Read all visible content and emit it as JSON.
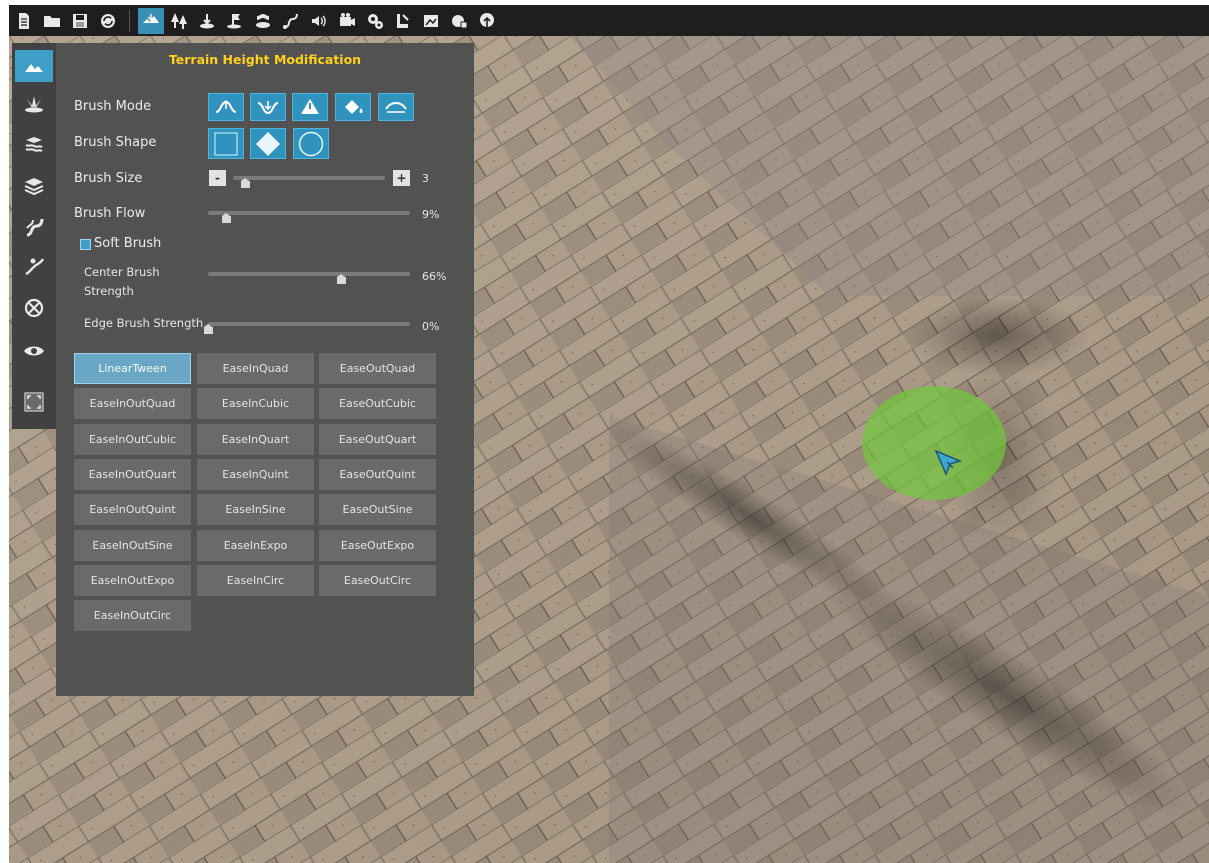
{
  "toolbar": {
    "file_icons": [
      "new-file-icon",
      "open-folder-icon",
      "save-icon",
      "refresh-icon"
    ],
    "tool_icons": [
      "terrain-height-icon",
      "trees-icon",
      "place-object-icon",
      "flag-icon",
      "water-icon",
      "path-icon",
      "sound-icon",
      "camera-icon",
      "gears-icon",
      "lighting-icon",
      "paint-icon",
      "plugin-icon",
      "nature-icon"
    ],
    "active_tool": "terrain-height-icon"
  },
  "rail": {
    "items": [
      "terrain-raise-icon",
      "grass-icon",
      "layers-texture-icon",
      "stack-icon",
      "road-icon",
      "path-tool-icon",
      "no-entry-icon",
      "eye-icon",
      "fullscreen-icon"
    ],
    "active": "terrain-raise-icon"
  },
  "panel": {
    "title": "Terrain Height Modification",
    "brush_mode_label": "Brush Mode",
    "brush_mode_icons": [
      "raise-icon",
      "lower-icon",
      "flatten-icon",
      "fill-icon",
      "smooth-icon"
    ],
    "brush_shape_label": "Brush Shape",
    "brush_shapes": [
      "square-shape-icon",
      "diamond-shape-icon",
      "circle-shape-icon"
    ],
    "brush_size_label": "Brush Size",
    "brush_size_minus": "-",
    "brush_size_plus": "+",
    "brush_size_value": "3",
    "brush_size_level": 0.08,
    "brush_flow_label": "Brush Flow",
    "brush_flow_value": "9%",
    "brush_flow_level": 0.09,
    "soft_brush_label": "Soft Brush",
    "soft_brush_checked": true,
    "center_strength_label_line1": "Center Brush",
    "center_strength_label_line2": "Strength",
    "center_strength_value": "66%",
    "center_strength_level": 0.66,
    "edge_strength_label": "Edge Brush Strength",
    "edge_strength_value": "0%",
    "edge_strength_level": 0.0,
    "easing": [
      [
        "LinearTween",
        "EaseInQuad",
        "EaseOutQuad"
      ],
      [
        "EaseInOutQuad",
        "EaseInCubic",
        "EaseOutCubic"
      ],
      [
        "EaseInOutCubic",
        "EaseInQuart",
        "EaseOutQuart"
      ],
      [
        "EaseInOutQuart",
        "EaseInQuint",
        "EaseOutQuint"
      ],
      [
        "EaseInOutQuint",
        "EaseInSine",
        "EaseOutSine"
      ],
      [
        "EaseInOutSine",
        "EaseInExpo",
        "EaseOutExpo"
      ],
      [
        "EaseInOutExpo",
        "EaseInCirc",
        "EaseOutCirc"
      ],
      [
        "EaseInOutCirc"
      ]
    ],
    "selected_easing": "LinearTween"
  },
  "colors": {
    "accent": "#3f9fc7",
    "title": "#ffd21e",
    "panel_bg": "#525252",
    "brush_cursor": "#7fd13b"
  }
}
